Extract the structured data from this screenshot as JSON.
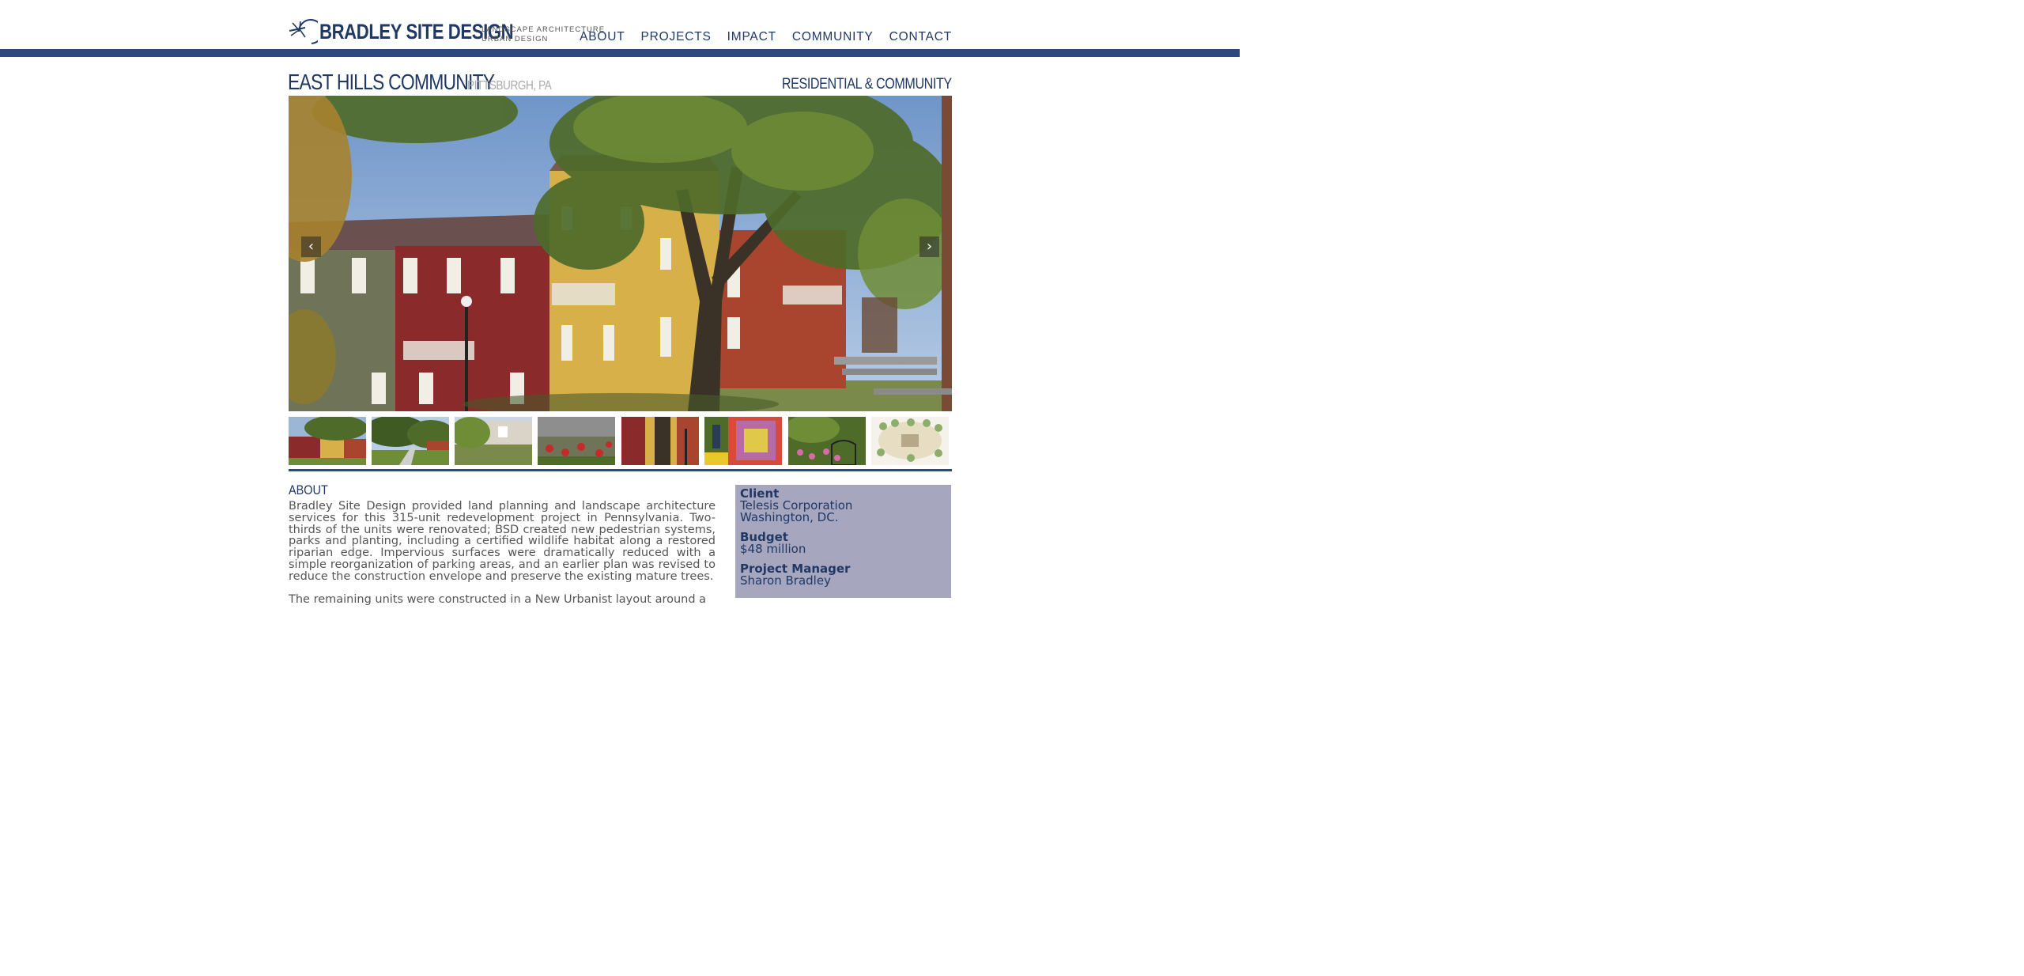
{
  "brand": {
    "name": "BRADLEY SITE DESIGN",
    "tagline_line1": "LANDSCAPE ARCHITECTURE",
    "tagline_line2": "URBAN DESIGN",
    "color": "#1f3864"
  },
  "nav": {
    "items": [
      "ABOUT",
      "PROJECTS",
      "IMPACT",
      "COMMUNITY",
      "CONTACT"
    ]
  },
  "project": {
    "title": "EAST HILLS COMMUNITY",
    "location": "PITTSBURGH, PA",
    "category": "RESIDENTIAL & COMMUNITY"
  },
  "slider": {
    "prev_icon": "‹",
    "next_icon": "›",
    "thumbnail_count": 8
  },
  "about": {
    "heading": "ABOUT",
    "paragraph1": "Bradley Site Design provided land planning and landscape architecture services for this 315-unit redevelopment project in Pennsylvania. Two-thirds of the units were renovated; BSD created new pedestrian systems, parks and planting, including a certified wildlife habitat along a restored riparian edge. Impervious surfaces were dramatically reduced with a simple reorganization of parking areas, and an earlier plan was revised to reduce the construction envelope and preserve the existing mature trees.",
    "paragraph2": "The remaining units were constructed in a New Urbanist layout around a"
  },
  "info": {
    "client_label": "Client",
    "client_line1": "Telesis Corporation",
    "client_line2": "Washington, DC.",
    "budget_label": "Budget",
    "budget_value": "$48 million",
    "manager_label": "Project Manager",
    "manager_value": "Sharon Bradley"
  },
  "colors": {
    "accent": "#2c4a7e",
    "panel": "#a6a6bf",
    "muted": "#a8a8a8"
  }
}
